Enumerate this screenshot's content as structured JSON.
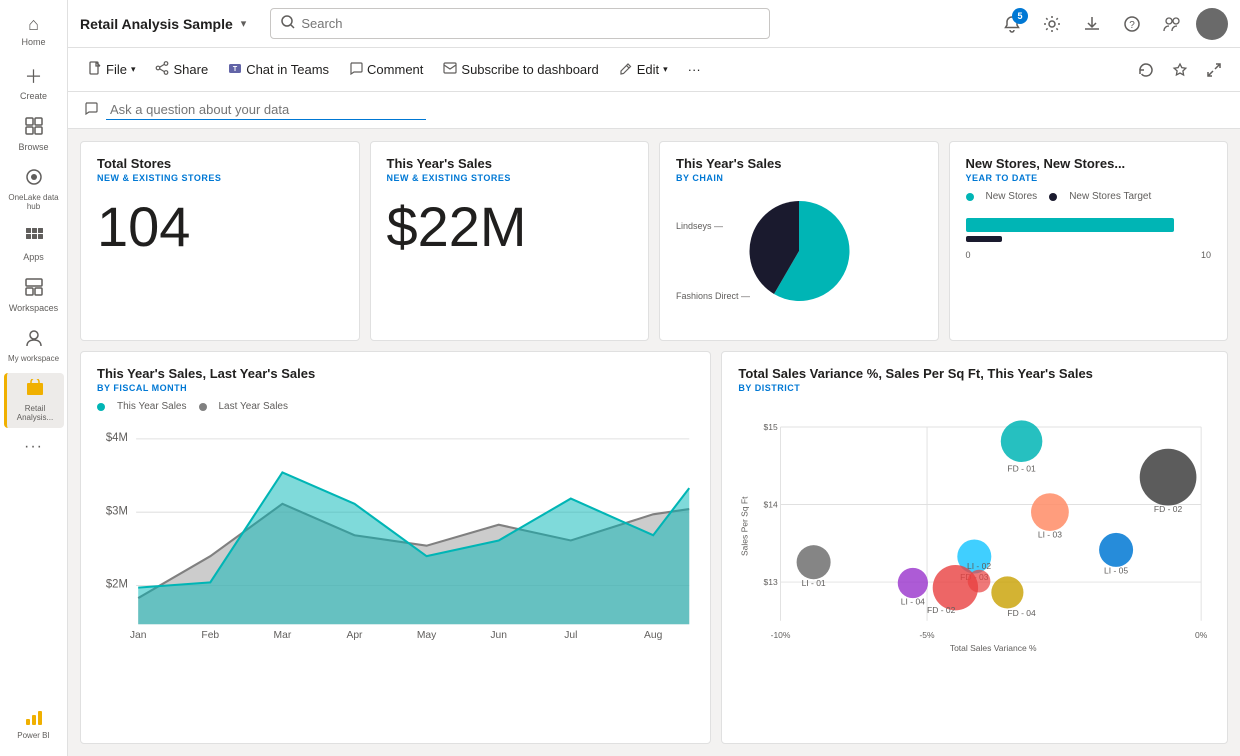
{
  "app": {
    "title": "Retail Analysis Sample",
    "search_placeholder": "Search"
  },
  "sidebar": {
    "items": [
      {
        "id": "home",
        "label": "Home",
        "icon": "⌂"
      },
      {
        "id": "create",
        "label": "Create",
        "icon": "+"
      },
      {
        "id": "browse",
        "label": "Browse",
        "icon": "❑"
      },
      {
        "id": "onelake",
        "label": "OneLake data hub",
        "icon": "◎"
      },
      {
        "id": "apps",
        "label": "Apps",
        "icon": "⊞"
      },
      {
        "id": "workspaces",
        "label": "Workspaces",
        "icon": "▦"
      },
      {
        "id": "myworkspace",
        "label": "My workspace",
        "icon": "○"
      },
      {
        "id": "retail",
        "label": "Retail Analysis...",
        "icon": "★",
        "active": true
      },
      {
        "id": "more",
        "label": "...",
        "icon": "···"
      }
    ],
    "powerbi_label": "Power BI"
  },
  "topbar": {
    "notifications_badge": "5",
    "icons": [
      "notifications",
      "settings",
      "download",
      "help",
      "share-contacts",
      "user"
    ]
  },
  "toolbar": {
    "file_label": "File",
    "share_label": "Share",
    "chat_label": "Chat in Teams",
    "comment_label": "Comment",
    "subscribe_label": "Subscribe to dashboard",
    "edit_label": "Edit",
    "more_icon": "···"
  },
  "qa": {
    "placeholder": "Ask a question about your data"
  },
  "cards": {
    "total_stores": {
      "title": "Total Stores",
      "subtitle": "NEW & EXISTING STORES",
      "value": "104"
    },
    "this_year_sales": {
      "title": "This Year's Sales",
      "subtitle": "NEW & EXISTING STORES",
      "value": "$22M"
    },
    "sales_by_chain": {
      "title": "This Year's Sales",
      "subtitle": "BY CHAIN",
      "labels": [
        "Lindseys",
        "Fashions Direct"
      ],
      "colors": [
        "#1a1a2e",
        "#00b5b5"
      ]
    },
    "new_stores": {
      "title": "New Stores, New Stores...",
      "subtitle": "YEAR TO DATE",
      "legend_new_stores": "New Stores",
      "legend_target": "New Stores Target",
      "axis_min": "0",
      "axis_max": "10",
      "bar_value": 85,
      "bar_line": 15
    }
  },
  "line_chart": {
    "title": "This Year's Sales, Last Year's Sales",
    "subtitle": "BY FISCAL MONTH",
    "legend_this_year": "This Year Sales",
    "legend_last_year": "Last Year Sales",
    "y_labels": [
      "$4M",
      "$3M",
      "$2M"
    ],
    "x_labels": [
      "Jan",
      "Feb",
      "Mar",
      "Apr",
      "May",
      "Jun",
      "Jul",
      "Aug"
    ],
    "colors": {
      "this_year": "#00b5b5",
      "last_year": "#808080"
    }
  },
  "scatter_chart": {
    "title": "Total Sales Variance %, Sales Per Sq Ft, This Year's Sales",
    "subtitle": "BY DISTRICT",
    "x_label": "Total Sales Variance %",
    "y_label": "Sales Per Sq Ft",
    "y_labels": [
      "$15",
      "$14",
      "$13"
    ],
    "x_labels": [
      "-10%",
      "-5%",
      "0%"
    ],
    "points": [
      {
        "id": "FD-01",
        "x": 55,
        "y": 10,
        "size": 28,
        "color": "#00b5b5"
      },
      {
        "id": "FD-02",
        "x": 92,
        "y": 35,
        "size": 38,
        "color": "#404040"
      },
      {
        "id": "LI-01",
        "x": 10,
        "y": 60,
        "size": 22,
        "color": "#606060"
      },
      {
        "id": "FD-03",
        "x": 58,
        "y": 62,
        "size": 22,
        "color": "#00bfff"
      },
      {
        "id": "LI-03",
        "x": 68,
        "y": 42,
        "size": 24,
        "color": "#ff8c66"
      },
      {
        "id": "LI-04",
        "x": 38,
        "y": 72,
        "size": 18,
        "color": "#aa00aa"
      },
      {
        "id": "FD-02b",
        "x": 48,
        "y": 78,
        "size": 30,
        "color": "#e84040"
      },
      {
        "id": "FD-04",
        "x": 60,
        "y": 82,
        "size": 20,
        "color": "#c8a000"
      },
      {
        "id": "LI-02",
        "x": 52,
        "y": 75,
        "size": 18,
        "color": "#e84040"
      },
      {
        "id": "LI-05",
        "x": 82,
        "y": 60,
        "size": 22,
        "color": "#0078d4"
      }
    ]
  }
}
